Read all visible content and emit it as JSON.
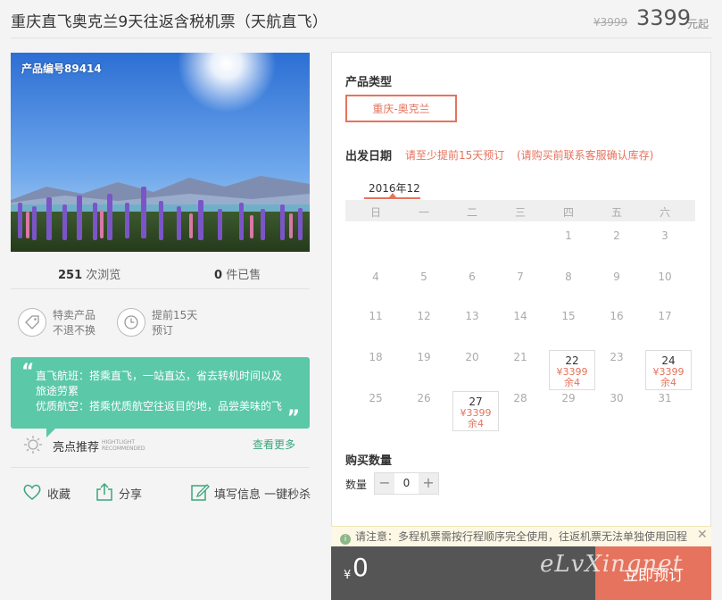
{
  "header": {
    "title": "重庆直飞奥克兰9天往返含税机票（天航直飞）",
    "old_price": "¥3999",
    "price": "3399",
    "price_unit": "元起"
  },
  "photo": {
    "code": "产品编号89414"
  },
  "stats": {
    "views_num": "251",
    "views_label": "次浏览",
    "sold_num": "0",
    "sold_label": "件已售"
  },
  "features": [
    {
      "line1": "特卖产品",
      "line2": "不退不换",
      "icon": "price-tag-icon"
    },
    {
      "line1": "提前15天",
      "line2": "预订",
      "icon": "clock-icon"
    }
  ],
  "highlight_box": {
    "open_quote": "“",
    "close_quote": "„",
    "line1": "直飞航班：搭乘直飞，一站直达，省去转机时间以及",
    "line2": "旅途劳累",
    "line3": "优质航空：搭乘优质航空往返目的地，品尝美味的飞"
  },
  "highlight": {
    "label": "亮点推荐",
    "en1": "HIGHTLIGHT",
    "en2": "RECOMMENDED",
    "more": "查看更多",
    "icon": "sun-icon"
  },
  "actions": {
    "favorite": "收藏",
    "share": "分享",
    "fill_info": "填写信息 一键秒杀"
  },
  "booking": {
    "type_heading": "产品类型",
    "type_option": "重庆-奥克兰",
    "date_heading": "出发日期",
    "date_note1": "请至少提前15天预订",
    "date_note2": "(请购买前联系客服确认库存)",
    "month": "2016年12",
    "weekdays": [
      "日",
      "一",
      "二",
      "三",
      "四",
      "五",
      "六"
    ],
    "days": [
      [
        "",
        "",
        "",
        "",
        "1",
        "2",
        "3"
      ],
      [
        "4",
        "5",
        "6",
        "7",
        "8",
        "9",
        "10"
      ],
      [
        "11",
        "12",
        "13",
        "14",
        "15",
        "16",
        "17"
      ],
      [
        "18",
        "19",
        "20",
        "21",
        "22",
        "23",
        "24"
      ],
      [
        "25",
        "26",
        "27",
        "28",
        "29",
        "30",
        "31"
      ]
    ],
    "available": {
      "22": {
        "price": "¥3399",
        "stock": "余4"
      },
      "24": {
        "price": "¥3399",
        "stock": "余4"
      },
      "27": {
        "price": "¥3399",
        "stock": "余4"
      }
    },
    "qty_heading": "购买数量",
    "qty_label": "数量",
    "qty_minus": "−",
    "qty_value": "0",
    "qty_plus": "+"
  },
  "notice": {
    "icon": "info-icon",
    "text": "请注意：多程机票需按行程顺序完全使用，往返机票无法单独使用回程",
    "close": "✕"
  },
  "pay": {
    "currency": "¥",
    "amount": "0",
    "button": "立即预订"
  },
  "watermark": "eLvXingnet",
  "colors": {
    "accent": "#e5735d",
    "green": "#5bc8a8",
    "link_green": "#3aa67c",
    "paybar": "#555555"
  }
}
